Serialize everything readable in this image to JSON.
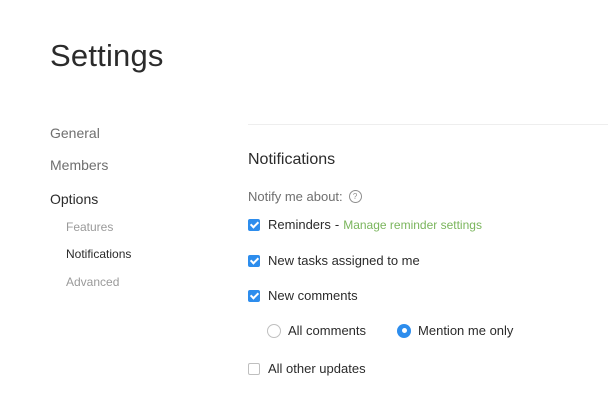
{
  "page": {
    "title": "Settings"
  },
  "sidebar": {
    "items": [
      {
        "label": "General"
      },
      {
        "label": "Members"
      },
      {
        "label": "Options"
      }
    ],
    "subitems": [
      {
        "label": "Features"
      },
      {
        "label": "Notifications",
        "active": true
      },
      {
        "label": "Advanced"
      }
    ]
  },
  "notifications": {
    "title": "Notifications",
    "notify_label": "Notify me about:",
    "help_icon": "question-circle-icon",
    "options": [
      {
        "label": "Reminders",
        "checked": true,
        "separator": "-",
        "link": "Manage reminder settings"
      },
      {
        "label": "New tasks assigned to me",
        "checked": true
      },
      {
        "label": "New comments",
        "checked": true
      },
      {
        "label": "All other updates",
        "checked": false
      }
    ],
    "comment_scope": {
      "options": [
        "All comments",
        "Mention me only"
      ],
      "selected": "Mention me only"
    }
  },
  "colors": {
    "accent": "#2d8ded",
    "link": "#7ab55c",
    "muted": "#9a9a9a"
  }
}
